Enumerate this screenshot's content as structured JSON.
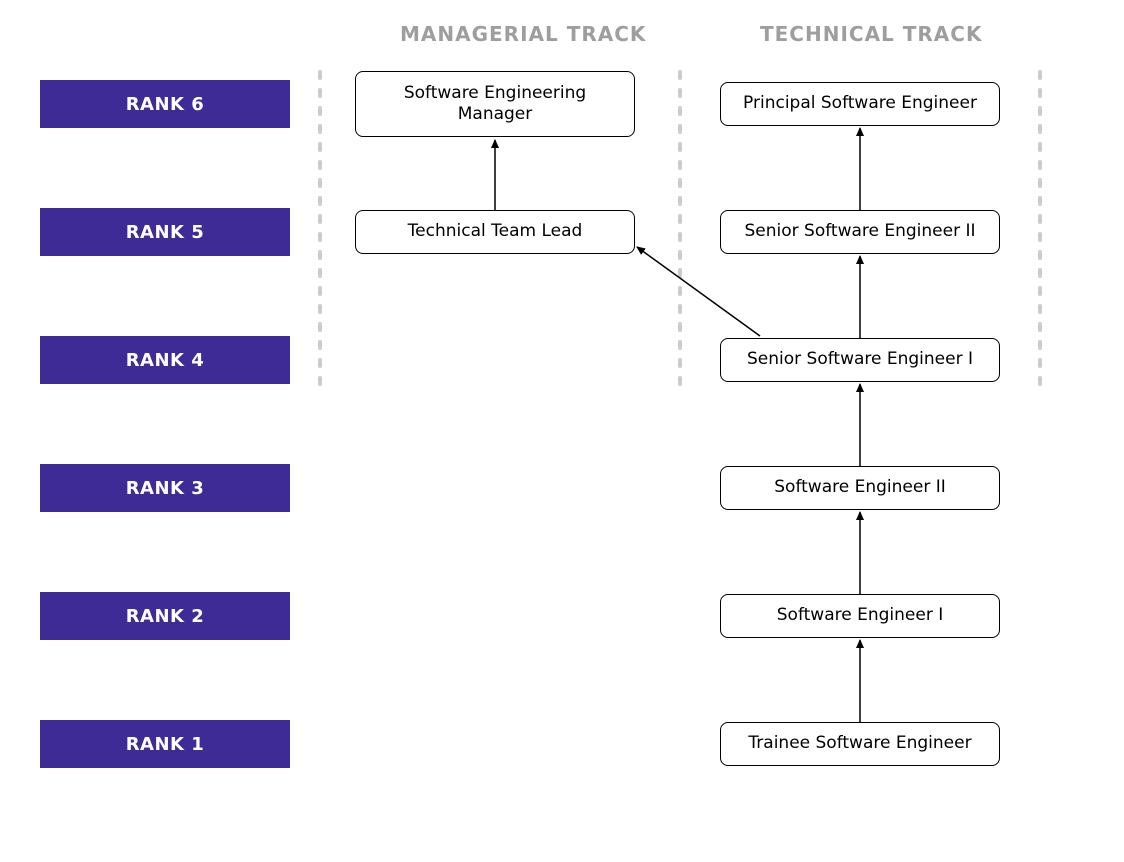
{
  "tracks": {
    "managerial": "MANAGERIAL TRACK",
    "technical": "TECHNICAL TRACK"
  },
  "ranks": {
    "r1": "RANK 1",
    "r2": "RANK 2",
    "r3": "RANK 3",
    "r4": "RANK 4",
    "r5": "RANK 5",
    "r6": "RANK 6"
  },
  "roles": {
    "trainee": "Trainee Software Engineer",
    "se1": "Software Engineer I",
    "se2": "Software Engineer II",
    "sse1": "Senior Software Engineer I",
    "sse2": "Senior Software Engineer II",
    "principal": "Principal Software Engineer",
    "ttl": "Technical Team Lead",
    "manager": "Software Engineering Manager"
  },
  "colors": {
    "rank_bg": "#3F2B96",
    "rank_text": "#FFFFFF",
    "track_header": "#9E9E9E",
    "box_border": "#000000",
    "divider": "#CCCCCC"
  },
  "diagram": {
    "edges": [
      {
        "from": "trainee",
        "to": "se1"
      },
      {
        "from": "se1",
        "to": "se2"
      },
      {
        "from": "se2",
        "to": "sse1"
      },
      {
        "from": "sse1",
        "to": "sse2"
      },
      {
        "from": "sse2",
        "to": "principal"
      },
      {
        "from": "sse1",
        "to": "ttl"
      },
      {
        "from": "ttl",
        "to": "manager"
      }
    ]
  }
}
